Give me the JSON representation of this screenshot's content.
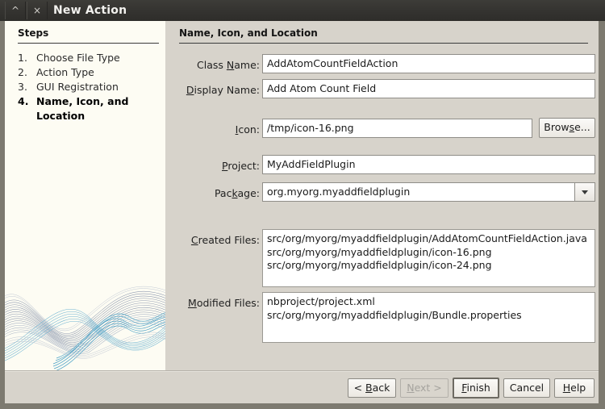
{
  "window": {
    "title": "New Action",
    "buttons": [
      {
        "name": "shade-button",
        "glyph": "^"
      },
      {
        "name": "close-button",
        "glyph": "×"
      }
    ]
  },
  "steps_panel": {
    "heading": "Steps",
    "items": [
      {
        "number": "1.",
        "label": "Choose File Type",
        "current": false
      },
      {
        "number": "2.",
        "label": "Action Type",
        "current": false
      },
      {
        "number": "3.",
        "label": "GUI Registration",
        "current": false
      },
      {
        "number": "4.",
        "label": "Name, Icon, and Location",
        "current": true
      }
    ]
  },
  "content": {
    "title": "Name, Icon, and Location",
    "fields": {
      "class_name": {
        "label_pre": "Class ",
        "label_mnemonic": "N",
        "label_post": "ame:",
        "value": "AddAtomCountFieldAction"
      },
      "display_name": {
        "label_pre": "",
        "label_mnemonic": "D",
        "label_post": "isplay Name:",
        "value": "Add Atom Count Field"
      },
      "icon": {
        "label_pre": "",
        "label_mnemonic": "I",
        "label_post": "con:",
        "value": "/tmp/icon-16.png"
      },
      "project": {
        "label_pre": "",
        "label_mnemonic": "P",
        "label_post": "roject:",
        "value": "MyAddFieldPlugin"
      },
      "package": {
        "label_pre": "Pac",
        "label_mnemonic": "k",
        "label_post": "age:",
        "value": "org.myorg.myaddfieldplugin"
      },
      "created_files": {
        "label_pre": "",
        "label_mnemonic": "C",
        "label_post": "reated Files:",
        "value": "src/org/myorg/myaddfieldplugin/AddAtomCountFieldAction.java\nsrc/org/myorg/myaddfieldplugin/icon-16.png\nsrc/org/myorg/myaddfieldplugin/icon-24.png"
      },
      "modified_files": {
        "label_pre": "",
        "label_mnemonic": "M",
        "label_post": "odified Files:",
        "value": "nbproject/project.xml\nsrc/org/myorg/myaddfieldplugin/Bundle.properties"
      }
    },
    "browse_button": {
      "pre": "Brow",
      "mnemonic": "s",
      "post": "e..."
    },
    "package_dropdown_icon": "chevron-down-icon"
  },
  "buttonbar": {
    "back": {
      "pre": "< ",
      "mnemonic": "B",
      "post": "ack",
      "disabled": false,
      "default": false
    },
    "next": {
      "pre": "",
      "mnemonic": "N",
      "post": "ext >",
      "disabled": true,
      "default": false
    },
    "finish": {
      "pre": "",
      "mnemonic": "F",
      "post": "inish",
      "disabled": false,
      "default": true
    },
    "cancel": {
      "pre": "Cancel",
      "mnemonic": "",
      "post": "",
      "disabled": false,
      "default": false
    },
    "help": {
      "pre": "",
      "mnemonic": "H",
      "post": "elp",
      "disabled": false,
      "default": false
    }
  },
  "colors": {
    "titlebar": "#343330",
    "dialog_bg": "#d7d3cb",
    "steps_bg": "#fdfcf3",
    "field_bg": "#ffffff",
    "wave_blue": "#4a9bc4",
    "wave_gray": "#6b7a93"
  }
}
